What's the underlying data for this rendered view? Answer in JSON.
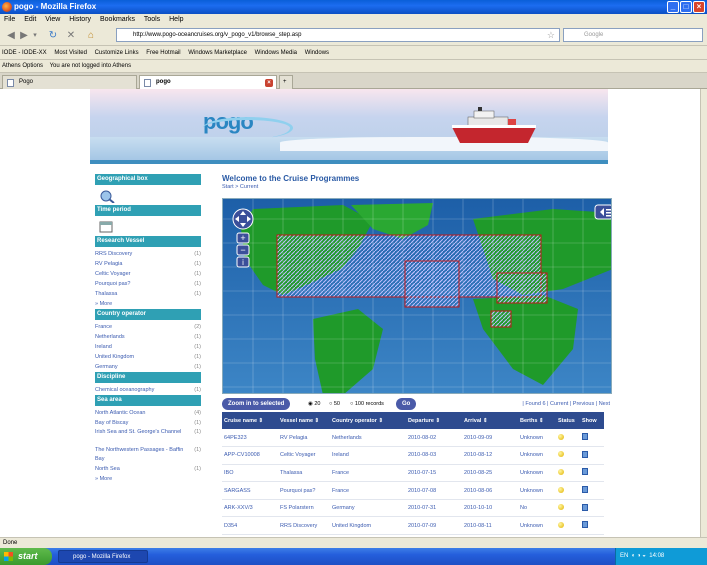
{
  "window": {
    "title": "pogo - Mozilla Firefox",
    "min_symbol": "_",
    "max_symbol": "□",
    "close_symbol": "×"
  },
  "menu": [
    "File",
    "Edit",
    "View",
    "History",
    "Bookmarks",
    "Tools",
    "Help"
  ],
  "nav": {
    "url": "http://www.pogo-oceancruises.org/v_pogo_v1/browse_step.asp",
    "search_placeholder": "Google"
  },
  "bookmarks": [
    "IODE - IODE-XX",
    "Most Visited",
    "Customize Links",
    "Free Hotmail",
    "Windows Marketplace",
    "Windows Media",
    "Windows"
  ],
  "athens": {
    "options": "Athens Options",
    "status": "You are not logged into Athens"
  },
  "tabs": [
    {
      "label": "Pogo"
    },
    {
      "label": "pogo"
    }
  ],
  "page": {
    "logo": "pogo",
    "welcome": "Welcome to the Cruise Programmes",
    "breadcrumb": "Start > Current",
    "sidebar": {
      "geo_box": "Geographical box",
      "time_period": "Time period",
      "research_vessel": "Research Vessel",
      "vessels": [
        {
          "name": "RRS Discovery",
          "count": "(1)"
        },
        {
          "name": "RV Pelagia",
          "count": "(1)"
        },
        {
          "name": "Celtic Voyager",
          "count": "(1)"
        },
        {
          "name": "Pourquoi pas?",
          "count": "(1)"
        },
        {
          "name": "Thalassa",
          "count": "(1)"
        }
      ],
      "more": "More",
      "country_operator": "Country operator",
      "countries": [
        {
          "name": "France",
          "count": "(2)"
        },
        {
          "name": "Netherlands",
          "count": "(1)"
        },
        {
          "name": "Ireland",
          "count": "(1)"
        },
        {
          "name": "United Kingdom",
          "count": "(1)"
        },
        {
          "name": "Germany",
          "count": "(1)"
        }
      ],
      "discipline": "Discipline",
      "disciplines": [
        {
          "name": "Chemical oceanography",
          "count": "(1)"
        }
      ],
      "sea_area": "Sea area",
      "seas": [
        {
          "name": "North Atlantic Ocean",
          "count": "(4)"
        },
        {
          "name": "Bay of Biscay",
          "count": "(1)"
        },
        {
          "name": "Irish Sea and St. George's Channel",
          "count": "(1)"
        },
        {
          "name": "The Northwestern Passages - Baffin Bay",
          "count": "(1)"
        },
        {
          "name": "North Sea",
          "count": "(1)"
        }
      ],
      "more2": "More"
    },
    "controls": {
      "zoom_button": "Zoom in to selected",
      "opt20": "20",
      "opt50": "50",
      "opt100": "100 records",
      "go_button": "Go",
      "results_info": "| Found 6 | Current | Previous | Next"
    },
    "table": {
      "headers": [
        "Cruise name",
        "Vessel name",
        "Country operator",
        "Departure",
        "Arrival",
        "Berths",
        "Status",
        "Show"
      ],
      "rows": [
        [
          "64PE323",
          "RV Pelagia",
          "Netherlands",
          "2010-08-02",
          "2010-09-09",
          "Unknown"
        ],
        [
          "APP-CV10008",
          "Celtic Voyager",
          "Ireland",
          "2010-08-03",
          "2010-08-12",
          "Unknown"
        ],
        [
          "IBO",
          "Thalassa",
          "France",
          "2010-07-15",
          "2010-08-25",
          "Unknown"
        ],
        [
          "SARGASS",
          "Pourquoi pas?",
          "France",
          "2010-07-08",
          "2010-08-06",
          "Unknown"
        ],
        [
          "ARK-XXV/3",
          "FS Polarstern",
          "Germany",
          "2010-07-31",
          "2010-10-10",
          "No"
        ],
        [
          "D354",
          "RRS Discovery",
          "United Kingdom",
          "2010-07-09",
          "2010-08-11",
          "Unknown"
        ]
      ]
    }
  },
  "status_bar": "Done",
  "taskbar": {
    "start": "start",
    "item": "pogo - Mozilla Firefox",
    "lang": "EN",
    "clock": "14:08"
  },
  "colors": {
    "sidebar_header": "#2fa0b4",
    "table_header": "#2e4b8f",
    "link": "#3b5bb0"
  }
}
